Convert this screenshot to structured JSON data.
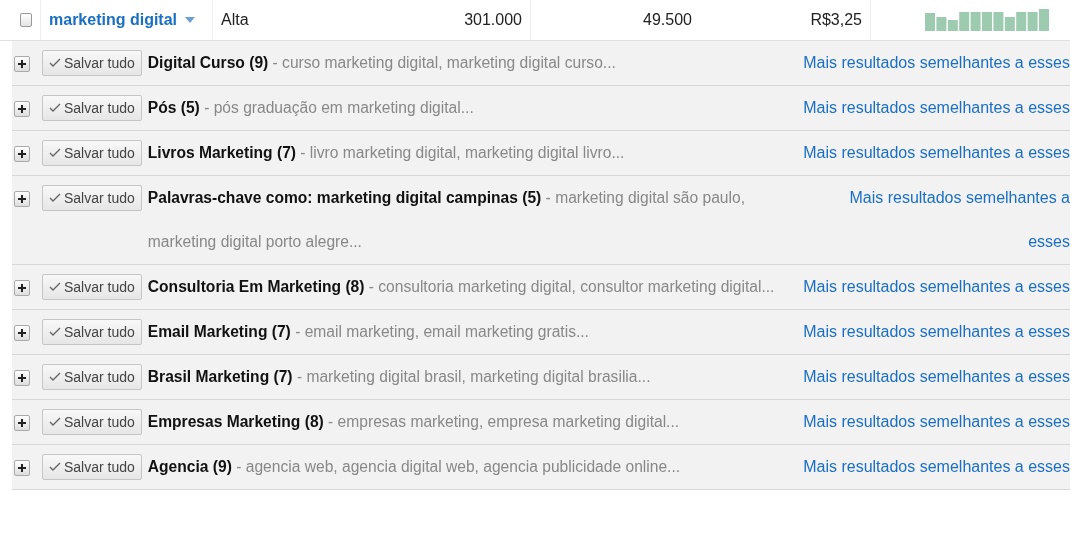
{
  "keyword_row": {
    "checked": false,
    "keyword": "marketing digital",
    "competition": "Alta",
    "global_searches": "301.000",
    "local_searches": "49.500",
    "cpc": "R$3,25"
  },
  "groups": [
    {
      "title": "Digital Curso (9)",
      "description": " - curso marketing digital, marketing digital curso...",
      "save": "Salvar tudo",
      "link": "Mais resultados semelhantes a esses"
    },
    {
      "title": "Pós (5)",
      "description": " - pós graduação em marketing digital...",
      "save": "Salvar tudo",
      "link": "Mais resultados semelhantes a esses"
    },
    {
      "title": "Livros Marketing (7)",
      "description": " - livro marketing digital, marketing digital livro...",
      "save": "Salvar tudo",
      "link": "Mais resultados semelhantes a esses"
    },
    {
      "title": "Palavras-chave como: marketing digital campinas (5)",
      "description": " - marketing digital são paulo, marketing digital porto alegre...",
      "save": "Salvar tudo",
      "link": "Mais resultados semelhantes a esses"
    },
    {
      "title": "Consultoria Em Marketing (8)",
      "description": " - consultoria marketing digital, consultor marketing digital...",
      "save": "Salvar tudo",
      "link": "Mais resultados semelhantes a esses"
    },
    {
      "title": "Email Marketing (7)",
      "description": " - email marketing, email marketing gratis...",
      "save": "Salvar tudo",
      "link": "Mais resultados semelhantes a esses"
    },
    {
      "title": "Brasil Marketing (7)",
      "description": " - marketing digital brasil, marketing digital brasilia...",
      "save": "Salvar tudo",
      "link": "Mais resultados semelhantes a esses"
    },
    {
      "title": "Empresas Marketing (8)",
      "description": " - empresas marketing, empresa marketing digital...",
      "save": "Salvar tudo",
      "link": "Mais resultados semelhantes a esses"
    },
    {
      "title": "Agencia (9)",
      "description": " - agencia web, agencia digital web, agencia publicidade online...",
      "save": "Salvar tudo",
      "link": "Mais resultados semelhantes a esses"
    }
  ]
}
